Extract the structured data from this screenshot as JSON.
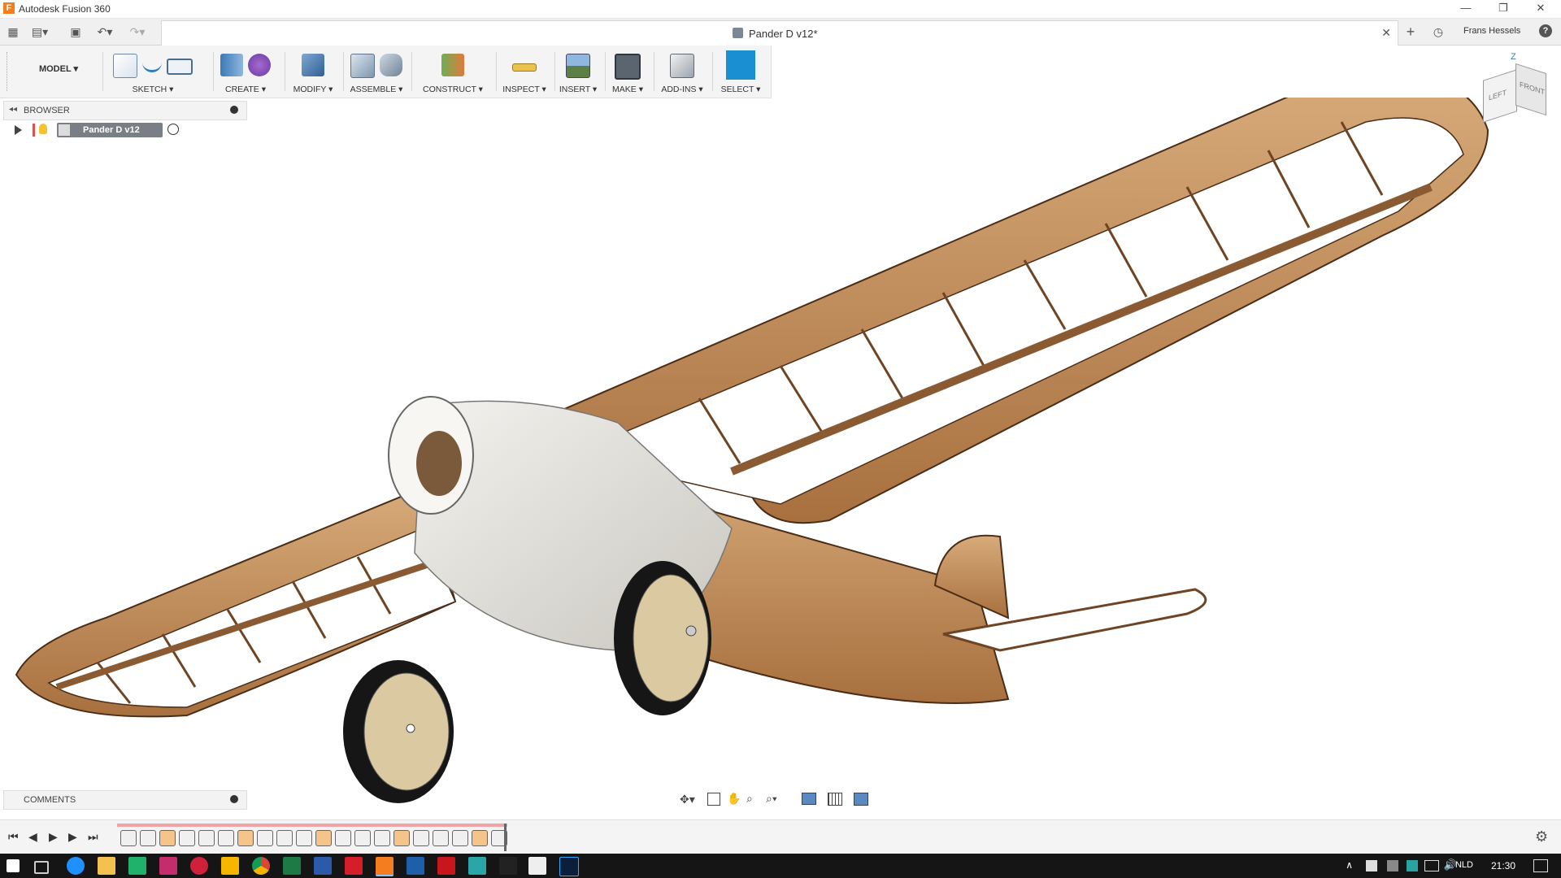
{
  "window": {
    "app_title": "Autodesk Fusion 360",
    "logo_letter": "F"
  },
  "tab": {
    "title": "Pander D v12*",
    "close": "✕",
    "add": "+"
  },
  "user": {
    "name": "Frans Hessels",
    "help": "?"
  },
  "workspace": {
    "label": "MODEL ▾"
  },
  "toolbar": {
    "sketch": "SKETCH ▾",
    "create": "CREATE ▾",
    "modify": "MODIFY ▾",
    "assemble": "ASSEMBLE ▾",
    "construct": "CONSTRUCT ▾",
    "inspect": "INSPECT ▾",
    "insert": "INSERT ▾",
    "make": "MAKE ▾",
    "addins": "ADD-INS ▾",
    "select": "SELECT ▾"
  },
  "browser": {
    "title": "BROWSER",
    "root_label": "Pander D v12"
  },
  "comments": {
    "title": "COMMENTS"
  },
  "viewcube": {
    "left": "LEFT",
    "front": "FRONT",
    "axis_z": "Z"
  },
  "taskbar": {
    "lang": "NLD",
    "time": "21:30"
  },
  "colors": {
    "accent": "#1a8fd1",
    "wood": "#c99865",
    "wood_dark": "#8a5a33",
    "cowl": "#e9e7e2",
    "taskbar": "#151515"
  }
}
